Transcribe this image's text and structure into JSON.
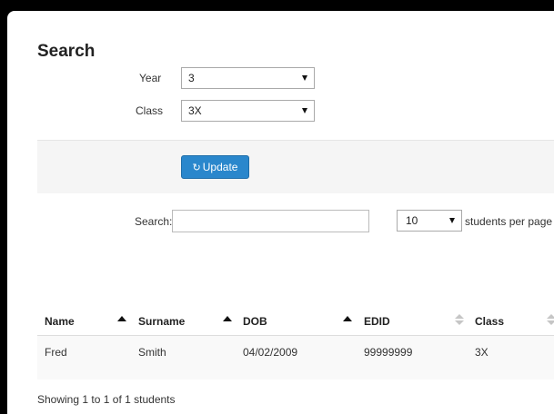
{
  "page": {
    "title": "Search"
  },
  "filters": {
    "year_label": "Year",
    "year_value": "3",
    "class_label": "Class",
    "class_value": "3X"
  },
  "update_button": {
    "label": "Update",
    "icon": "refresh-icon"
  },
  "search": {
    "label": "Search:",
    "value": ""
  },
  "page_size": {
    "value": "10",
    "suffix": "students per page"
  },
  "table": {
    "columns": [
      "Name",
      "Surname",
      "DOB",
      "EDID",
      "Class"
    ],
    "rows": [
      [
        "Fred",
        "Smith",
        "04/02/2009",
        "99999999",
        "3X"
      ]
    ]
  },
  "info": {
    "prefix": "Showing ",
    "start": "1",
    "to": " to ",
    "end": "1",
    "of": " of ",
    "total": "1",
    "suffix": " students"
  },
  "colors": {
    "button": "#2a87cc",
    "band": "#f5f5f5"
  }
}
